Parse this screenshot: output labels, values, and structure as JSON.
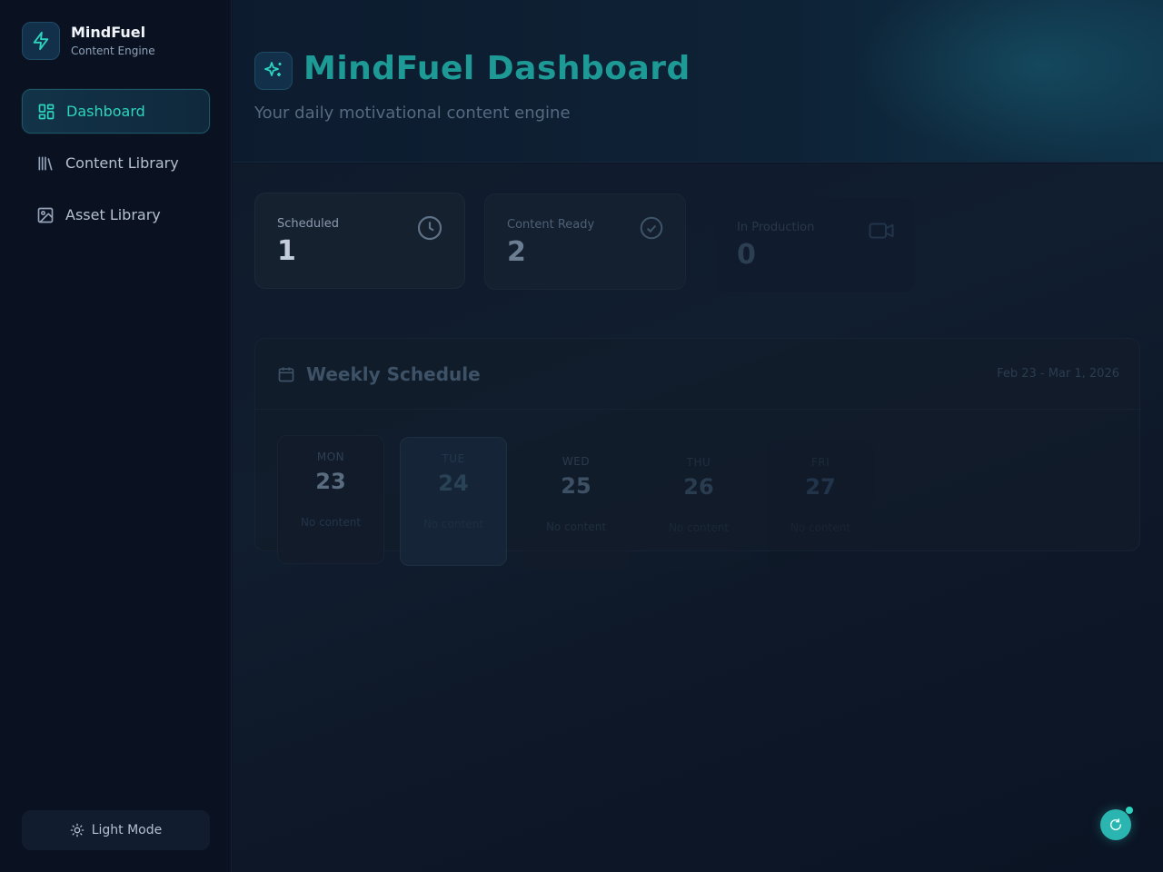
{
  "brand": {
    "title": "MindFuel",
    "subtitle": "Content Engine"
  },
  "sidebar": {
    "items": [
      {
        "label": "Dashboard",
        "icon": "grid-icon",
        "active": true
      },
      {
        "label": "Content Library",
        "icon": "library-icon",
        "active": false
      },
      {
        "label": "Asset Library",
        "icon": "image-icon",
        "active": false
      }
    ],
    "theme_toggle": "Light Mode"
  },
  "header": {
    "title": "MindFuel Dashboard",
    "subtitle": "Your daily motivational content engine",
    "icon": "sparkles-icon"
  },
  "stats": [
    {
      "label": "Scheduled",
      "value": "1",
      "icon": "clock-icon"
    },
    {
      "label": "Content Ready",
      "value": "2",
      "icon": "check-circle-icon"
    },
    {
      "label": "In Production",
      "value": "0",
      "icon": "video-icon"
    }
  ],
  "schedule": {
    "title": "Weekly Schedule",
    "range": "Feb 23 - Mar 1, 2026",
    "days": [
      {
        "name": "MON",
        "num": "23",
        "status": "No content"
      },
      {
        "name": "TUE",
        "num": "24",
        "status": "No content"
      },
      {
        "name": "WED",
        "num": "25",
        "status": "No content"
      },
      {
        "name": "THU",
        "num": "26",
        "status": "No content"
      },
      {
        "name": "FRI",
        "num": "27",
        "status": "No content"
      }
    ]
  },
  "colors": {
    "accent": "#2dd4bf",
    "sidebar_bg": "#0a1222",
    "main_bg": "#0b1424"
  }
}
